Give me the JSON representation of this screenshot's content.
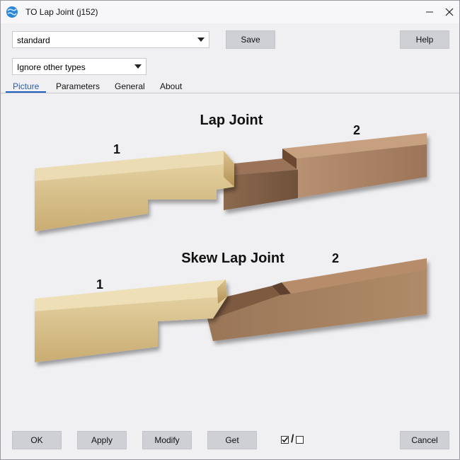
{
  "window": {
    "title": "TO Lap Joint (j152)"
  },
  "toolbar": {
    "preset_value": "standard",
    "save_label": "Save",
    "help_label": "Help"
  },
  "filter": {
    "value": "Ignore other types"
  },
  "tabs": [
    {
      "label": "Picture",
      "active": true
    },
    {
      "label": "Parameters",
      "active": false
    },
    {
      "label": "General",
      "active": false
    },
    {
      "label": "About",
      "active": false
    }
  ],
  "picture": {
    "top_title": "Lap Joint",
    "top_label_1": "1",
    "top_label_2": "2",
    "bottom_title": "Skew Lap Joint",
    "bottom_label_1": "1",
    "bottom_label_2": "2"
  },
  "footer": {
    "ok_label": "OK",
    "apply_label": "Apply",
    "modify_label": "Modify",
    "get_label": "Get",
    "toggle_separator": "/",
    "cancel_label": "Cancel"
  },
  "colors": {
    "accent": "#1f5fbf",
    "button": "#cfd0d6",
    "background": "#f0f0f3"
  },
  "icons": {
    "app": "app-globe-icon",
    "minimize": "minimize-icon",
    "close": "close-icon"
  }
}
